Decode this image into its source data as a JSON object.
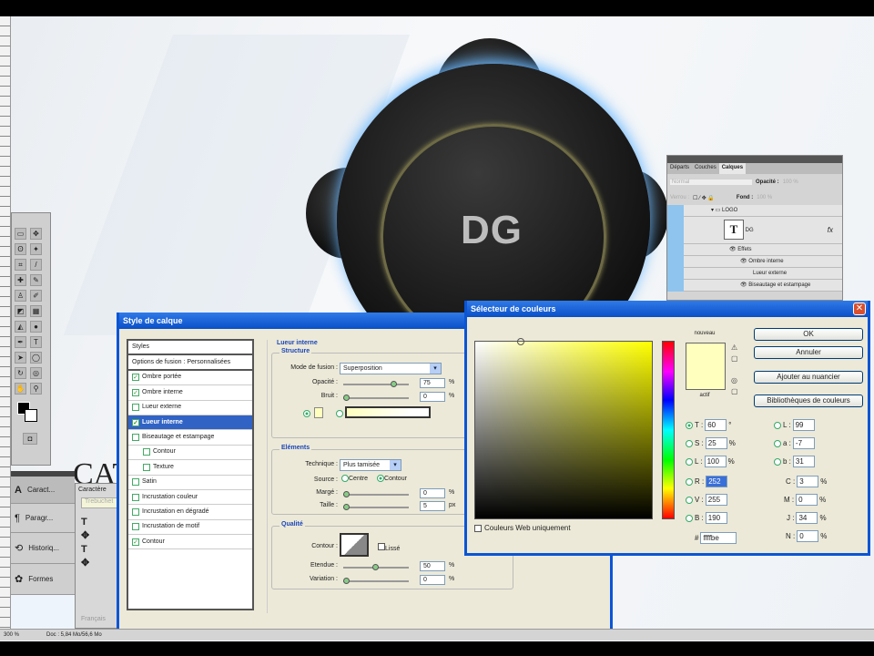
{
  "canvas": {
    "logo_text": "DG",
    "title_fragment": "CAT"
  },
  "status": {
    "zoom": "300 %",
    "doc": "Doc : 5,84 Mo/56,6 Mo"
  },
  "dock": {
    "items": [
      {
        "label": "Caract..."
      },
      {
        "label": "Paragr..."
      },
      {
        "label": "Historiq..."
      },
      {
        "label": "Formes"
      }
    ]
  },
  "character_panel": {
    "tab": "Caractère",
    "font": "Trebuchet",
    "language": "Français"
  },
  "layers": {
    "tabs": [
      "Départs",
      "Couches",
      "Calques"
    ],
    "active_tab": "Calques",
    "blend_mode": "Normal",
    "opacity_label": "Opacité :",
    "opacity": "100 %",
    "lock_label": "Verrou :",
    "fill_label": "Fond :",
    "fill": "100 %",
    "rows": [
      {
        "name": "LOGO"
      },
      {
        "name": "DG",
        "fx": "fx"
      },
      {
        "name": "Effets"
      },
      {
        "name": "Ombre interne"
      },
      {
        "name": "Lueur externe"
      },
      {
        "name": "Biseautage et estampage"
      }
    ]
  },
  "layer_style": {
    "title": "Style de calque",
    "list": [
      {
        "label": "Styles"
      },
      {
        "label": "Options de fusion : Personnalisées"
      },
      {
        "label": "Ombre portée",
        "checked": true
      },
      {
        "label": "Ombre interne",
        "checked": true
      },
      {
        "label": "Lueur externe",
        "checked": false
      },
      {
        "label": "Lueur interne",
        "checked": true,
        "selected": true
      },
      {
        "label": "Biseautage et estampage",
        "checked": false
      },
      {
        "label": "Contour",
        "checked": false,
        "indent": true
      },
      {
        "label": "Texture",
        "checked": false,
        "indent": true
      },
      {
        "label": "Satin",
        "checked": false
      },
      {
        "label": "Incrustation couleur",
        "checked": false
      },
      {
        "label": "Incrustation en dégradé",
        "checked": false
      },
      {
        "label": "Incrustation de motif",
        "checked": false
      },
      {
        "label": "Contour",
        "checked": true
      }
    ],
    "section_title": "Lueur interne",
    "structure": {
      "title": "Structure",
      "blend_label": "Mode de fusion :",
      "blend": "Superposition",
      "opacity_label": "Opacité :",
      "opacity": "75",
      "noise_label": "Bruit :",
      "noise": "0",
      "unit": "%"
    },
    "elements": {
      "title": "Eléments",
      "technique_label": "Technique :",
      "technique": "Plus tamisée",
      "source_label": "Source :",
      "source_center": "Centre",
      "source_edge": "Contour",
      "choke_label": "Margé :",
      "choke": "0",
      "size_label": "Taille :",
      "size": "5",
      "size_unit": "px"
    },
    "quality": {
      "title": "Qualité",
      "contour_label": "Contour :",
      "smooth_label": "Lissé",
      "range_label": "Etendue :",
      "range": "50",
      "jitter_label": "Variation :",
      "jitter": "0"
    }
  },
  "color_picker": {
    "title": "Sélecteur de couleurs",
    "new_label": "nouveau",
    "current_label": "actif",
    "new_color": "#ffffbe",
    "buttons": {
      "ok": "OK",
      "cancel": "Annuler",
      "add_swatch": "Ajouter au nuancier",
      "libraries": "Bibliothèques de couleurs"
    },
    "web_only_label": "Couleurs Web uniquement",
    "fields": {
      "T": "60",
      "S": "25",
      "L": "100",
      "R": "252",
      "V": "255",
      "B": "190",
      "Lab_L": "99",
      "a": "-7",
      "b": "31",
      "C": "3",
      "M": "0",
      "J": "34",
      "N": "0"
    },
    "units": {
      "deg": "°",
      "pct": "%"
    },
    "hex": "ffffbe"
  }
}
